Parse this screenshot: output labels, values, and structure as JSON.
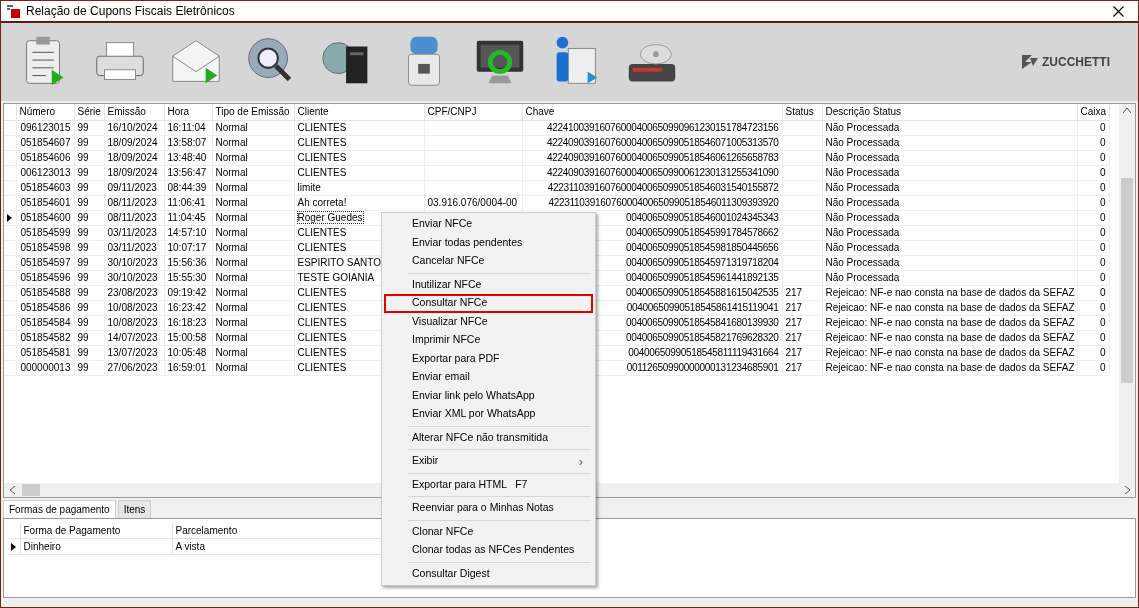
{
  "window": {
    "title": "Relação de Cupons Fiscais Eletrônicos"
  },
  "toolbar": {
    "brand": "ZUCCHETTI"
  },
  "table": {
    "columns": [
      "Número",
      "Série",
      "Emissão",
      "Hora",
      "Tipo de Emissão",
      "Cliente",
      "CPF/CNPJ",
      "Chave",
      "Status",
      "Descrição Status",
      "Caixa"
    ],
    "rows": [
      {
        "numero": "096123015",
        "serie": "99",
        "emissao": "16/10/2024",
        "hora": "16:11:04",
        "tipo": "Normal",
        "cliente": "CLIENTES",
        "chave": "42241003916076000400650990961230151784723156",
        "descricao": "Não Processada",
        "caixa": "0",
        "current": false
      },
      {
        "numero": "051854607",
        "serie": "99",
        "emissao": "18/09/2024",
        "hora": "13:58:07",
        "tipo": "Normal",
        "cliente": "CLIENTES",
        "chave": "42240903916076000400650990518546071005313570",
        "descricao": "Não Processada",
        "caixa": "0",
        "current": false
      },
      {
        "numero": "051854606",
        "serie": "99",
        "emissao": "18/09/2024",
        "hora": "13:48:40",
        "tipo": "Normal",
        "cliente": "CLIENTES",
        "chave": "42240903916076000400650990518546061265658783",
        "descricao": "Não Processada",
        "caixa": "0",
        "current": false
      },
      {
        "numero": "006123013",
        "serie": "99",
        "emissao": "18/09/2024",
        "hora": "13:56:47",
        "tipo": "Normal",
        "cliente": "CLIENTES",
        "chave": "42240903916076000400650990061230131255341090",
        "descricao": "Não Processada",
        "caixa": "0",
        "current": false
      },
      {
        "numero": "051854603",
        "serie": "99",
        "emissao": "09/11/2023",
        "hora": "08:44:39",
        "tipo": "Normal",
        "cliente": "limite",
        "chave": "42231103916076000400650990518546031540155872",
        "descricao": "Não Processada",
        "caixa": "0",
        "current": false
      },
      {
        "numero": "051854601",
        "serie": "99",
        "emissao": "08/11/2023",
        "hora": "11:06:41",
        "tipo": "Normal",
        "cliente": "Ah correta!",
        "cpf": "03.916.076/0004-00",
        "chave": "42231103916076000400650990518546011309393920",
        "descricao": "Não Processada",
        "caixa": "0",
        "current": false
      },
      {
        "numero": "051854600",
        "serie": "99",
        "emissao": "08/11/2023",
        "hora": "11:04:45",
        "tipo": "Normal",
        "cliente": "Roger Guedes",
        "chave": "00400650990518546001024345343",
        "descricao": "Não Processada",
        "caixa": "0",
        "current": true
      },
      {
        "numero": "051854599",
        "serie": "99",
        "emissao": "03/11/2023",
        "hora": "14:57:10",
        "tipo": "Normal",
        "cliente": "CLIENTES",
        "chave": "00400650990518545991784578662",
        "descricao": "Não Processada",
        "caixa": "0",
        "current": false
      },
      {
        "numero": "051854598",
        "serie": "99",
        "emissao": "03/11/2023",
        "hora": "10:07:17",
        "tipo": "Normal",
        "cliente": "CLIENTES",
        "chave": "00400650990518545981850445656",
        "descricao": "Não Processada",
        "caixa": "0",
        "current": false
      },
      {
        "numero": "051854597",
        "serie": "99",
        "emissao": "30/10/2023",
        "hora": "15:56:36",
        "tipo": "Normal",
        "cliente": "ESPIRITO SANTO",
        "chave": "00400650990518545971319718204",
        "descricao": "Não Processada",
        "caixa": "0",
        "current": false
      },
      {
        "numero": "051854596",
        "serie": "99",
        "emissao": "30/10/2023",
        "hora": "15:55:30",
        "tipo": "Normal",
        "cliente": "TESTE GOIANIA",
        "chave": "00400650990518545961441892135",
        "descricao": "Não Processada",
        "caixa": "0",
        "current": false
      },
      {
        "numero": "051854588",
        "serie": "99",
        "emissao": "23/08/2023",
        "hora": "09:19:42",
        "tipo": "Normal",
        "cliente": "CLIENTES",
        "chave": "00400650990518545881615042535",
        "status": "217",
        "descricao": "Rejeicao: NF-e nao consta na base de dados da SEFAZ",
        "caixa": "0",
        "current": false
      },
      {
        "numero": "051854586",
        "serie": "99",
        "emissao": "10/08/2023",
        "hora": "16:23:42",
        "tipo": "Normal",
        "cliente": "CLIENTES",
        "chave": "00400650990518545861415119041",
        "status": "217",
        "descricao": "Rejeicao: NF-e nao consta na base de dados da SEFAZ",
        "caixa": "0",
        "current": false
      },
      {
        "numero": "051854584",
        "serie": "99",
        "emissao": "10/08/2023",
        "hora": "16:18:23",
        "tipo": "Normal",
        "cliente": "CLIENTES",
        "chave": "00400650990518545841680139930",
        "status": "217",
        "descricao": "Rejeicao: NF-e nao consta na base de dados da SEFAZ",
        "caixa": "0",
        "current": false
      },
      {
        "numero": "051854582",
        "serie": "99",
        "emissao": "14/07/2023",
        "hora": "15:00:58",
        "tipo": "Normal",
        "cliente": "CLIENTES",
        "chave": "00400650990518545821769628320",
        "status": "217",
        "descricao": "Rejeicao: NF-e nao consta na base de dados da SEFAZ",
        "caixa": "0",
        "current": false
      },
      {
        "numero": "051854581",
        "serie": "99",
        "emissao": "13/07/2023",
        "hora": "10:05:48",
        "tipo": "Normal",
        "cliente": "CLIENTES",
        "chave": "00400650990518545811119431664",
        "status": "217",
        "descricao": "Rejeicao: NF-e nao consta na base de dados da SEFAZ",
        "caixa": "0",
        "current": false
      },
      {
        "numero": "000000013",
        "serie": "99",
        "emissao": "27/06/2023",
        "hora": "16:59:01",
        "tipo": "Normal",
        "cliente": "CLIENTES",
        "chave": "00112650990000000131234685901",
        "status": "217",
        "descricao": "Rejeicao: NF-e nao consta na base de dados da SEFAZ",
        "caixa": "0",
        "current": false
      }
    ]
  },
  "bottom_tabs": [
    {
      "label": "Formas de pagamento",
      "selected": true
    },
    {
      "label": "Itens",
      "selected": false
    }
  ],
  "payments": {
    "columns": [
      "Forma de Pagamento",
      "Parcelamento"
    ],
    "rows": [
      {
        "forma": "Dinheiro",
        "parcelamento": "A vista",
        "current": true
      }
    ]
  },
  "context_menu": [
    {
      "kind": "item",
      "label": "Enviar NFCe",
      "selected": false
    },
    {
      "kind": "item",
      "label": "Enviar todas pendentes",
      "selected": false
    },
    {
      "kind": "item",
      "label": "Cancelar NFCe",
      "selected": false
    },
    {
      "kind": "separator"
    },
    {
      "kind": "item",
      "label": "Inutilizar NFCe",
      "selected": false
    },
    {
      "kind": "item",
      "label": "Consultar NFCe",
      "selected": true
    },
    {
      "kind": "item",
      "label": "Visualizar NFCe",
      "selected": false
    },
    {
      "kind": "item",
      "label": "Imprimir NFCe",
      "selected": false
    },
    {
      "kind": "item",
      "label": "Exportar para PDF",
      "selected": false
    },
    {
      "kind": "item",
      "label": "Enviar email",
      "selected": false
    },
    {
      "kind": "item",
      "label": "Enviar link pelo WhatsApp",
      "selected": false
    },
    {
      "kind": "item",
      "label": "Enviar XML por WhatsApp",
      "selected": false
    },
    {
      "kind": "separator"
    },
    {
      "kind": "item",
      "label": "Alterar NFCe não transmitida",
      "selected": false
    },
    {
      "kind": "separator"
    },
    {
      "kind": "submenu",
      "label": "Exibir",
      "arrow": "›",
      "selected": false
    },
    {
      "kind": "separator"
    },
    {
      "kind": "item",
      "label": "Exportar para HTML",
      "shortcut": "F7",
      "selected": false
    },
    {
      "kind": "separator"
    },
    {
      "kind": "item",
      "label": "Reenviar para o Minhas Notas",
      "selected": false
    },
    {
      "kind": "separator"
    },
    {
      "kind": "item",
      "label": "Clonar NFCe",
      "selected": false
    },
    {
      "kind": "item",
      "label": "Clonar todas as NFCes Pendentes",
      "selected": false
    },
    {
      "kind": "separator"
    },
    {
      "kind": "item",
      "label": "Consultar Digest",
      "selected": false
    }
  ]
}
